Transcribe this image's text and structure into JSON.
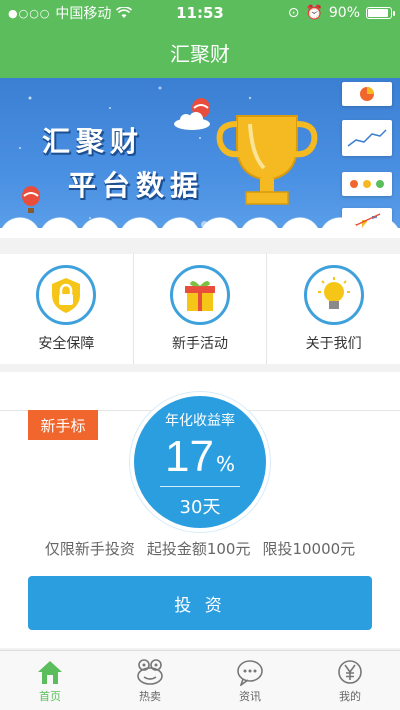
{
  "status_bar": {
    "carrier": "中国移动",
    "time": "11:53",
    "battery": "90%",
    "battery_level": 0.9
  },
  "nav": {
    "title": "汇聚财"
  },
  "banner": {
    "line1": "汇聚财",
    "line2": "平台数据",
    "slides_total": 3,
    "active_slide": 0
  },
  "quick_menu": [
    {
      "label": "安全保障",
      "icon": "lock-shield-icon"
    },
    {
      "label": "新手活动",
      "icon": "gift-icon"
    },
    {
      "label": "关于我们",
      "icon": "lightbulb-icon"
    }
  ],
  "product": {
    "tag": "新手标",
    "rate_label": "年化收益率",
    "rate": "17",
    "rate_unit": "%",
    "term": "30天",
    "info_1": "仅限新手投资",
    "info_2": "起投金额100元",
    "info_3": "限投10000元",
    "button": "投 资"
  },
  "tabs": [
    {
      "label": "首页",
      "icon": "home-icon",
      "active": true
    },
    {
      "label": "热卖",
      "icon": "frog-icon",
      "active": false
    },
    {
      "label": "资讯",
      "icon": "chat-icon",
      "active": false
    },
    {
      "label": "我的",
      "icon": "yen-icon",
      "active": false
    }
  ],
  "colors": {
    "brand_green": "#5cbd5c",
    "primary_blue": "#2b9ee0",
    "tag_orange": "#f0662c"
  }
}
